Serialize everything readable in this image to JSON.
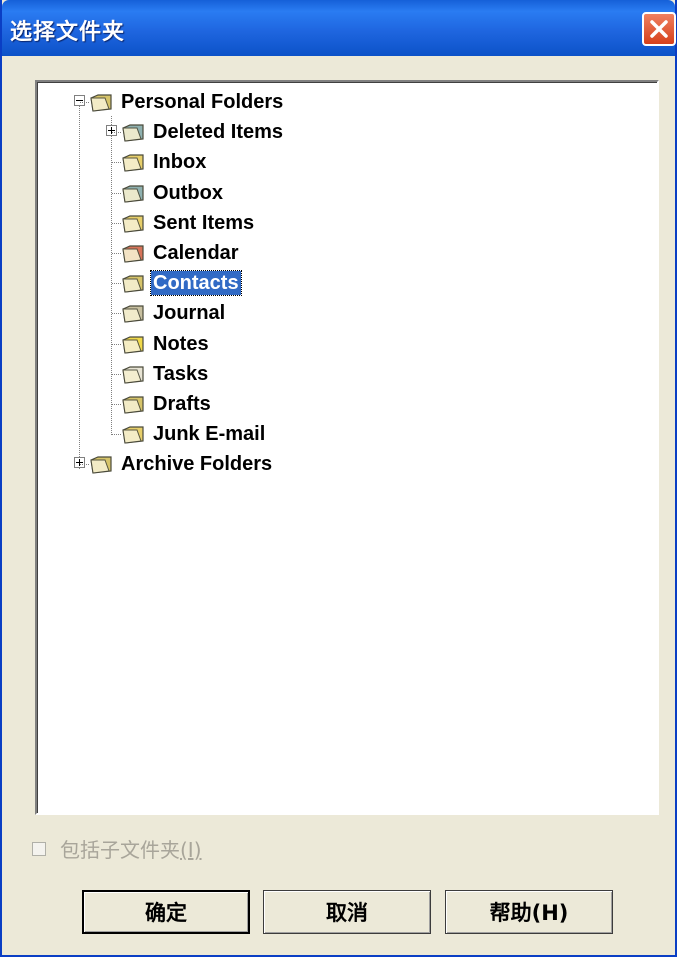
{
  "dialog": {
    "title": "选择文件夹"
  },
  "tree": {
    "items": [
      {
        "label": "Personal Folders",
        "icon": "personal-folders-icon",
        "color": "#d6c46a"
      },
      {
        "label": "Deleted Items",
        "icon": "trash-icon",
        "color": "#8fb1b0"
      },
      {
        "label": "Inbox",
        "icon": "inbox-icon",
        "color": "#e7cf6b"
      },
      {
        "label": "Outbox",
        "icon": "outbox-icon",
        "color": "#8fb1b0"
      },
      {
        "label": "Sent Items",
        "icon": "sent-items-icon",
        "color": "#e7cf6b"
      },
      {
        "label": "Calendar",
        "icon": "calendar-icon",
        "color": "#d8745a"
      },
      {
        "label": "Contacts",
        "icon": "contacts-icon",
        "color": "#d6c46a"
      },
      {
        "label": "Journal",
        "icon": "journal-icon",
        "color": "#c8c0a0"
      },
      {
        "label": "Notes",
        "icon": "notes-icon",
        "color": "#f0d94b"
      },
      {
        "label": "Tasks",
        "icon": "tasks-icon",
        "color": "#e8e4d4"
      },
      {
        "label": "Drafts",
        "icon": "drafts-icon",
        "color": "#d6c46a"
      },
      {
        "label": "Junk E-mail",
        "icon": "junk-email-icon",
        "color": "#e7cf6b"
      },
      {
        "label": "Archive Folders",
        "icon": "archive-folders-icon",
        "color": "#d6c46a"
      }
    ]
  },
  "options": {
    "include_subfolders_label": "包括子文件夹",
    "include_subfolders_hotkey": "(I)",
    "include_subfolders_checked": false
  },
  "buttons": {
    "ok": "确定",
    "cancel": "取消",
    "help": "帮助(H)"
  },
  "colors": {
    "selection": "#316ac5",
    "titlebar": "#1f66e0",
    "close": "#d6401c"
  }
}
